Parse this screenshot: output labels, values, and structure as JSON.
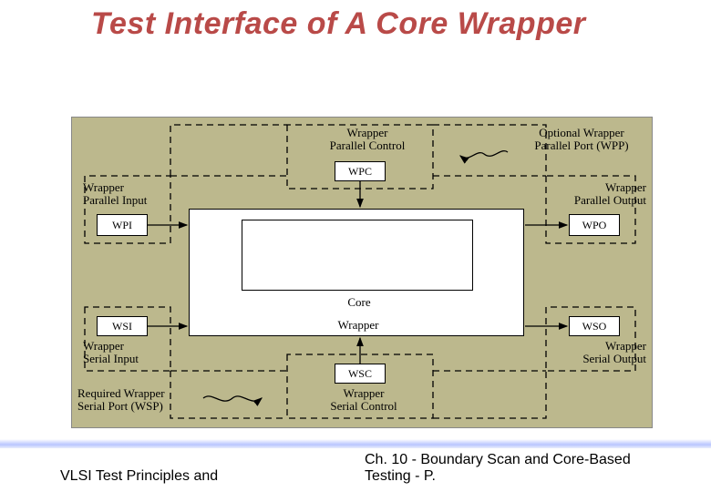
{
  "title": "Test Interface of A Core Wrapper",
  "footer": {
    "left": "VLSI Test Principles and",
    "right_line1": "Ch. 10 - Boundary Scan and Core-Based",
    "right_line2": "Testing - P."
  },
  "labels": {
    "wpi_desc1": "Wrapper",
    "wpi_desc2": "Parallel Input",
    "wpc_desc1": "Wrapper",
    "wpc_desc2": "Parallel Control",
    "wpp_desc1": "Optional Wrapper",
    "wpp_desc2": "Parallel Port (WPP)",
    "wpo_desc1": "Wrapper",
    "wpo_desc2": "Parallel Output",
    "wsi_desc1": "Wrapper",
    "wsi_desc2": "Serial Input",
    "wsc_desc1": "Wrapper",
    "wsc_desc2": "Serial Control",
    "wso_desc1": "Wrapper",
    "wso_desc2": "Serial Output",
    "wsp_desc1": "Required Wrapper",
    "wsp_desc2": "Serial Port (WSP)",
    "core": "Core",
    "wrapper": "Wrapper"
  },
  "boxes": {
    "wpi": "WPI",
    "wpc": "WPC",
    "wpo": "WPO",
    "wsi": "WSI",
    "wsc": "WSC",
    "wso": "WSO"
  }
}
